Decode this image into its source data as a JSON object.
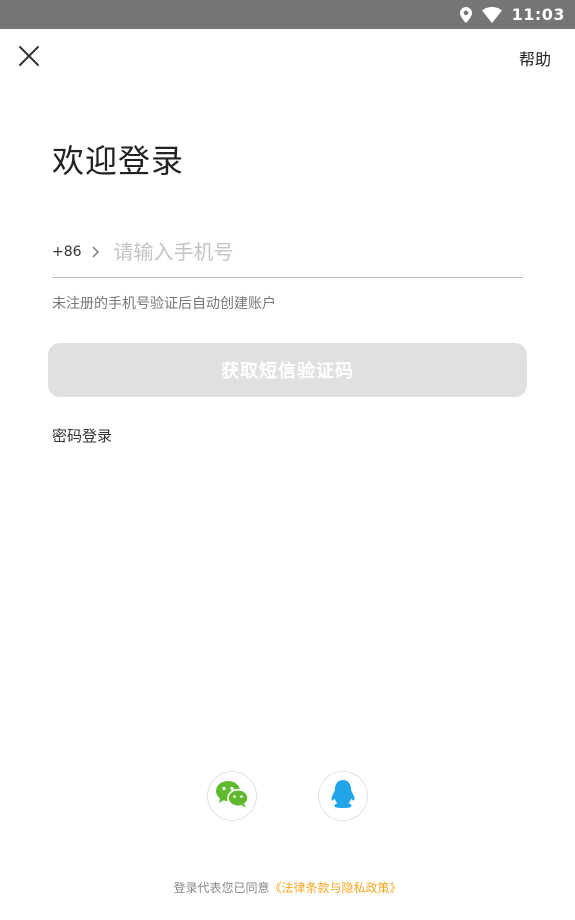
{
  "status_bar": {
    "time": "11:03",
    "icons": [
      "location-icon",
      "wifi-icon"
    ]
  },
  "nav": {
    "close_icon": "close-icon",
    "help_label": "帮助"
  },
  "login": {
    "title": "欢迎登录",
    "country_code": "+86",
    "phone_placeholder": "请输入手机号",
    "phone_value": "",
    "hint": "未注册的手机号验证后自动创建账户",
    "sms_button_label": "获取短信验证码",
    "password_login_label": "密码登录"
  },
  "social": {
    "items": [
      "wechat-icon",
      "qq-icon"
    ]
  },
  "agreement": {
    "prefix": "登录代表您已同意",
    "link_text": "《法律条款与隐私政策》"
  },
  "colors": {
    "status_bar": "#757575",
    "button_disabled": "#e0e0e0",
    "link_accent": "#f5a623",
    "wechat_green": "#5fba2f",
    "qq_blue": "#21a4e8"
  }
}
